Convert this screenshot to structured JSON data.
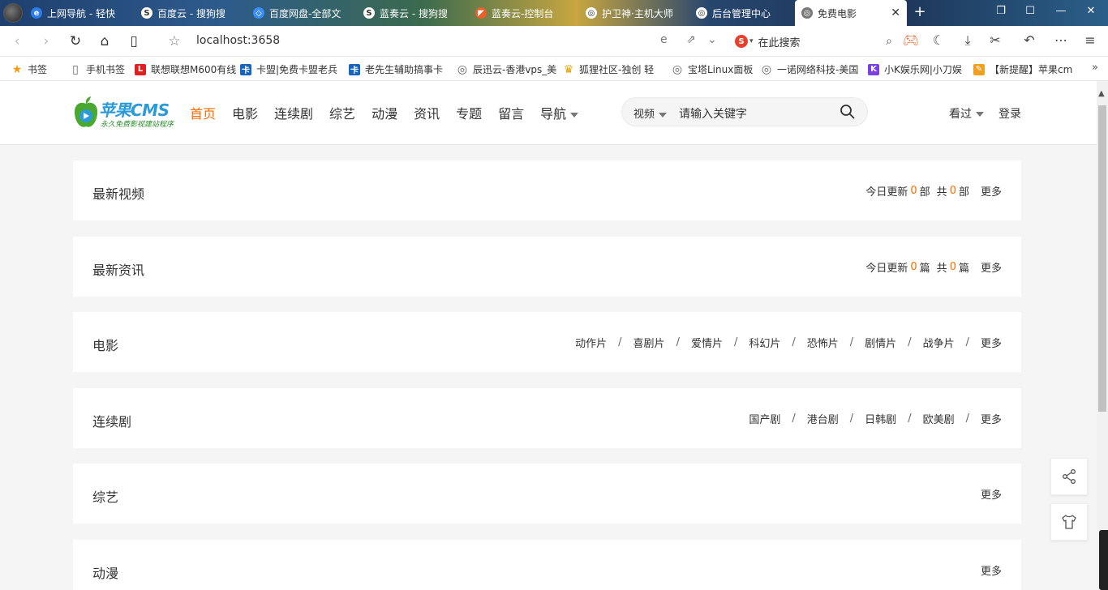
{
  "browser": {
    "tabs": [
      {
        "label": "上网导航 - 轻快",
        "icon_color": "#2b7de9",
        "icon": "e"
      },
      {
        "label": "百度云 - 搜狗搜",
        "icon_color": "#ffffff",
        "icon": "S"
      },
      {
        "label": "百度网盘-全部文",
        "icon_color": "#3a8ef6",
        "icon": "◇"
      },
      {
        "label": "蓝奏云 - 搜狗搜",
        "icon_color": "#ffffff",
        "icon": "S"
      },
      {
        "label": "蓝奏云-控制台",
        "icon_color": "#e8602c",
        "icon": "◤"
      },
      {
        "label": "护卫神·主机大师",
        "icon_color": "#ffffff",
        "icon": "◎"
      },
      {
        "label": "后台管理中心",
        "icon_color": "#ffffff",
        "icon": "◎"
      },
      {
        "label": "免费电影",
        "icon_color": "#777777",
        "icon": "◎"
      }
    ],
    "url": "localhost:3658",
    "search_placeholder": "在此搜索",
    "bookmarks": [
      {
        "label": "书签",
        "icon": "★",
        "color": "#f39c12"
      },
      {
        "label": "手机书签",
        "icon": "▯",
        "color": "#666666"
      },
      {
        "label": "联想联想M600有线",
        "icon": "L",
        "color": "#e02020"
      },
      {
        "label": "卡盟|免费卡盟老兵",
        "icon": "卡",
        "color": "#1565c0"
      },
      {
        "label": "老先生辅助搞事卡",
        "icon": "卡",
        "color": "#1565c0"
      },
      {
        "label": "辰迅云-香港vps_美",
        "icon": "◎",
        "color": "#666666"
      },
      {
        "label": "狐狸社区-独创 轻",
        "icon": "♛",
        "color": "#e6a300"
      },
      {
        "label": "宝塔Linux面板",
        "icon": "◎",
        "color": "#666666"
      },
      {
        "label": "一诺网络科技-美国",
        "icon": "◎",
        "color": "#666666"
      },
      {
        "label": "小K娱乐网|小刀娱",
        "icon": "K",
        "color": "#7b3fe4"
      },
      {
        "label": "【新提醒】苹果cm",
        "icon": "✎",
        "color": "#f0a020"
      }
    ]
  },
  "site": {
    "logo_title": "苹果CMS",
    "logo_sub": "永久免费影视建站程序",
    "nav": [
      {
        "label": "首页",
        "active": true
      },
      {
        "label": "电影",
        "active": false
      },
      {
        "label": "连续剧",
        "active": false
      },
      {
        "label": "综艺",
        "active": false
      },
      {
        "label": "动漫",
        "active": false
      },
      {
        "label": "资讯",
        "active": false
      },
      {
        "label": "专题",
        "active": false
      },
      {
        "label": "留言",
        "active": false
      },
      {
        "label": "导航",
        "active": false,
        "dropdown": true
      }
    ],
    "search_category": "视频",
    "search_placeholder": "请输入关键字",
    "history": "看过",
    "login": "登录",
    "accent": "#ff6a00"
  },
  "sections": [
    {
      "title": "最新视频",
      "stats": {
        "today_label": "今日更新",
        "today": "0",
        "unit": "部",
        "total_label": "共",
        "total": "0"
      },
      "more": "更多"
    },
    {
      "title": "最新资讯",
      "stats": {
        "today_label": "今日更新",
        "today": "0",
        "unit": "篇",
        "total_label": "共",
        "total": "0"
      },
      "more": "更多"
    },
    {
      "title": "电影",
      "links": [
        "动作片",
        "喜剧片",
        "爱情片",
        "科幻片",
        "恐怖片",
        "剧情片",
        "战争片"
      ],
      "more": "更多"
    },
    {
      "title": "连续剧",
      "links": [
        "国产剧",
        "港台剧",
        "日韩剧",
        "欧美剧"
      ],
      "more": "更多"
    },
    {
      "title": "综艺",
      "links": [],
      "more": "更多"
    },
    {
      "title": "动漫",
      "links": [],
      "more": "更多"
    }
  ],
  "float_buttons": [
    {
      "name": "share-icon"
    },
    {
      "name": "theme-shirt-icon"
    }
  ]
}
